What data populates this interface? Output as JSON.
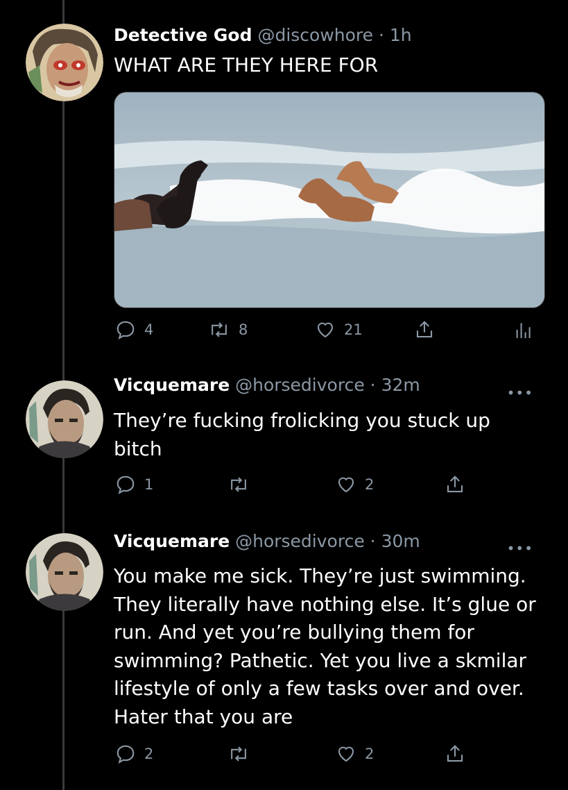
{
  "tweets": [
    {
      "name": "Detective God",
      "handle": "@discowhore",
      "separator": "·",
      "time": "1h",
      "text": "WHAT ARE THEY HERE FOR",
      "replies": "4",
      "retweets": "8",
      "likes": "21"
    },
    {
      "name": "Vicquemare",
      "handle": "@horsedivorce",
      "separator": "·",
      "time": "32m",
      "text": "They’re fucking frolicking you stuck up bitch",
      "replies": "1",
      "retweets": "",
      "likes": "2"
    },
    {
      "name": "Vicquemare",
      "handle": "@horsedivorce",
      "separator": "·",
      "time": "30m",
      "text": "You make me sick. They’re just swimming. They literally have nothing else. It’s glue or run. And yet you’re bullying them for swimming? Pathetic. Yet you live a skmilar lifestyle of only a few tasks over and over. Hater that you are",
      "replies": "2",
      "retweets": "",
      "likes": "2"
    }
  ],
  "more_glyph": "•••",
  "colors": {
    "background": "#000000",
    "secondary": "#8b98a5",
    "thread": "#3a3a3a"
  }
}
